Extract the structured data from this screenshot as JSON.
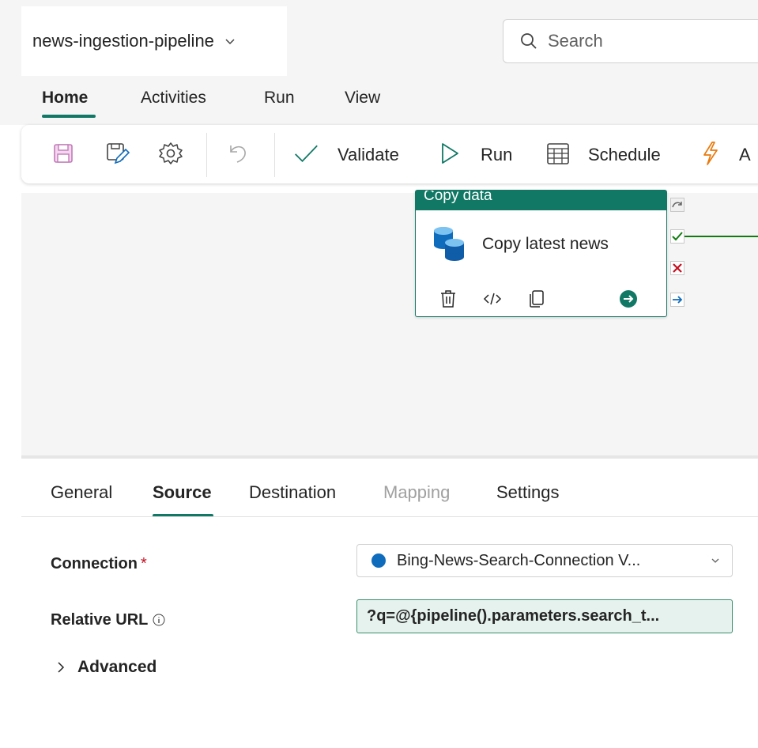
{
  "header": {
    "pipeline_name": "news-ingestion-pipeline",
    "search_placeholder": "Search"
  },
  "menu_tabs": [
    {
      "label": "Home",
      "active": true
    },
    {
      "label": "Activities",
      "active": false
    },
    {
      "label": "Run",
      "active": false
    },
    {
      "label": "View",
      "active": false
    }
  ],
  "toolbar": {
    "icons": [
      "save-icon",
      "save-as-icon",
      "settings-icon",
      "undo-icon"
    ],
    "validate_label": "Validate",
    "run_label": "Run",
    "schedule_label": "Schedule",
    "trigger_label": "A"
  },
  "canvas": {
    "activity": {
      "type_label": "Copy data",
      "name": "Copy latest news",
      "status_color": "#117865",
      "ports": [
        "skip",
        "success",
        "fail",
        "completion"
      ]
    }
  },
  "properties": {
    "tabs": [
      {
        "label": "General",
        "active": false,
        "disabled": false
      },
      {
        "label": "Source",
        "active": true,
        "disabled": false
      },
      {
        "label": "Destination",
        "active": false,
        "disabled": false
      },
      {
        "label": "Mapping",
        "active": false,
        "disabled": true
      },
      {
        "label": "Settings",
        "active": false,
        "disabled": false
      }
    ],
    "connection": {
      "label": "Connection",
      "required_mark": "*",
      "value": "Bing-News-Search-Connection V..."
    },
    "relative_url": {
      "label": "Relative URL",
      "value": "?q=@{pipeline().parameters.search_t..."
    },
    "advanced_label": "Advanced"
  },
  "colors": {
    "accent": "#117865",
    "success": "#107c10",
    "error": "#c50f1f",
    "link": "#0f6cbd"
  }
}
